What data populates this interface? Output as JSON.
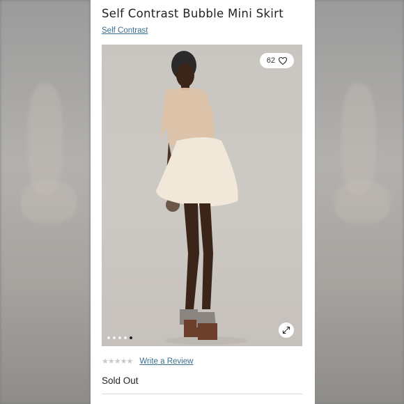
{
  "product": {
    "title": "Self Contrast Bubble Mini Skirt",
    "brand": "Self Contrast",
    "likes": "62",
    "review_link": "Write a Review",
    "stars": "★★★★★",
    "status": "Sold Out"
  },
  "gallery": {
    "image_count": 5,
    "active_index": 4,
    "like_icon": "heart-icon",
    "expand_icon": "expand-icon"
  },
  "colors": {
    "link": "#3a6f8f",
    "star": "#c9c9c9"
  }
}
